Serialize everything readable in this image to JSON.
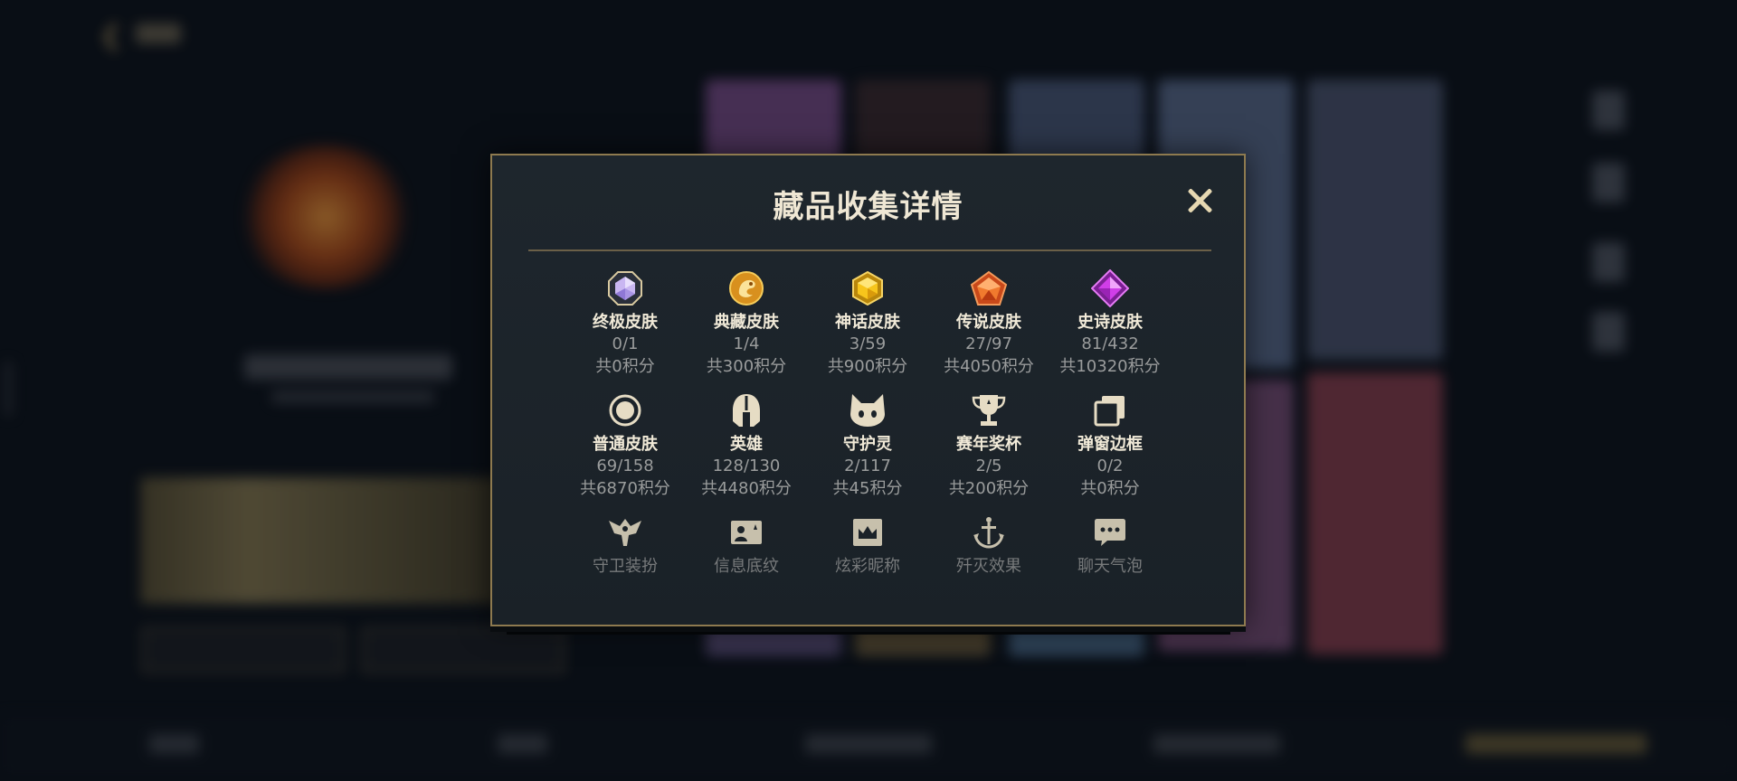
{
  "modal": {
    "title": "藏品收集详情",
    "close_icon": "close-icon"
  },
  "categories": [
    {
      "label": "终极皮肤",
      "count": "0/1",
      "points": "共0积分",
      "icon": "ultimate-skin-icon",
      "color": "#b8a4e8"
    },
    {
      "label": "典藏皮肤",
      "count": "1/4",
      "points": "共300积分",
      "icon": "treasured-skin-icon",
      "color": "#e0a22c"
    },
    {
      "label": "神话皮肤",
      "count": "3/59",
      "points": "共900积分",
      "icon": "mythic-skin-icon",
      "color": "#f2c021"
    },
    {
      "label": "传说皮肤",
      "count": "27/97",
      "points": "共4050积分",
      "icon": "legendary-skin-icon",
      "color": "#e8622a"
    },
    {
      "label": "史诗皮肤",
      "count": "81/432",
      "points": "共10320积分",
      "icon": "epic-skin-icon",
      "color": "#c43be0"
    },
    {
      "label": "普通皮肤",
      "count": "69/158",
      "points": "共6870积分",
      "icon": "normal-skin-icon",
      "color": "#e6dcc4"
    },
    {
      "label": "英雄",
      "count": "128/130",
      "points": "共4480积分",
      "icon": "hero-helmet-icon",
      "color": "#e6dcc4"
    },
    {
      "label": "守护灵",
      "count": "2/117",
      "points": "共45积分",
      "icon": "guardian-spirit-icon",
      "color": "#e6dcc4"
    },
    {
      "label": "赛年奖杯",
      "count": "2/5",
      "points": "共200积分",
      "icon": "season-trophy-icon",
      "color": "#e6dcc4"
    },
    {
      "label": "弹窗边框",
      "count": "0/2",
      "points": "共0积分",
      "icon": "popup-frame-icon",
      "color": "#e6dcc4"
    },
    {
      "label": "守卫装扮",
      "icon": "guard-outfit-icon",
      "color": "#e6dcc4"
    },
    {
      "label": "信息底纹",
      "icon": "info-background-icon",
      "color": "#e6dcc4"
    },
    {
      "label": "炫彩昵称",
      "icon": "colorful-nickname-icon",
      "color": "#e6dcc4"
    },
    {
      "label": "歼灭效果",
      "icon": "kill-effect-icon",
      "color": "#e6dcc4"
    },
    {
      "label": "聊天气泡",
      "icon": "chat-bubble-icon",
      "color": "#e6dcc4"
    }
  ]
}
